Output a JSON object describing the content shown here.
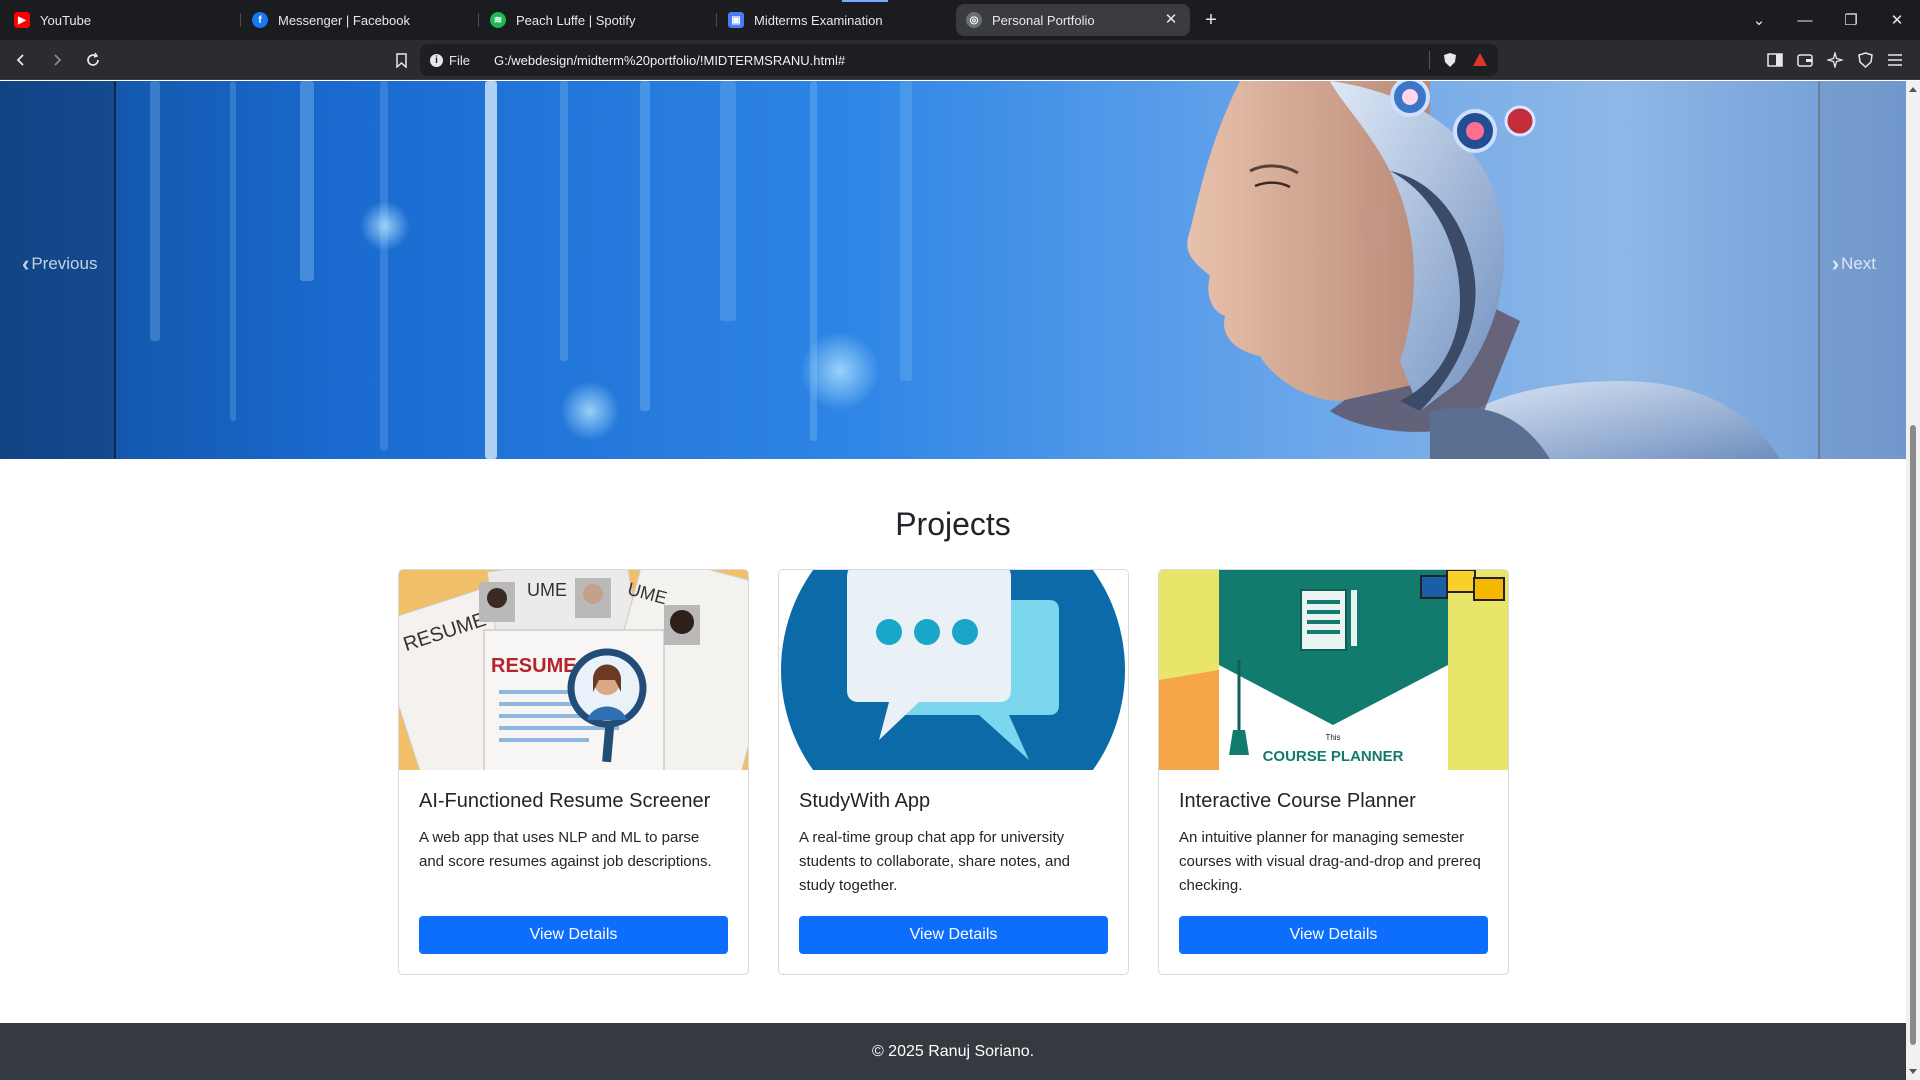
{
  "tabs": [
    {
      "label": "YouTube",
      "icon": "youtube-icon",
      "color": "#ff0000"
    },
    {
      "label": "Messenger | Facebook",
      "icon": "facebook-icon",
      "color": "#1877f2"
    },
    {
      "label": "Peach Luffe | Spotify",
      "icon": "spotify-icon",
      "color": "#1db954"
    },
    {
      "label": "Midterms Examination",
      "icon": "classroom-icon",
      "color": "#4a7bf7"
    },
    {
      "label": "Personal Portfolio",
      "icon": "globe-icon",
      "color": "#9aa0a6"
    }
  ],
  "toolbar": {
    "site_info": "File",
    "url": "G:/webdesign/midterm%20portfolio/!MIDTERMSRANU.html#"
  },
  "carousel": {
    "prev_label": "Previous",
    "next_label": "Next"
  },
  "projects": {
    "heading": "Projects",
    "cards": [
      {
        "title": "AI-Functioned Resume Screener",
        "description": "A web app that uses NLP and ML to parse and score resumes against job descriptions.",
        "button": "View Details",
        "image_text": [
          "RESUME",
          "UME",
          "UME",
          "RESUME"
        ]
      },
      {
        "title": "StudyWith App",
        "description": "A real-time group chat app for university students to collaborate, share notes, and study together.",
        "button": "View Details"
      },
      {
        "title": "Interactive Course Planner",
        "description": "An intuitive planner for managing semester courses with visual drag-and-drop and prereq checking.",
        "button": "View Details",
        "image_text": [
          "This",
          "COURSE PLANNER"
        ]
      }
    ]
  },
  "footer": {
    "text": "© 2025 Ranuj Soriano."
  },
  "colors": {
    "primary_button": "#0d6efd",
    "footer_bg": "#343a40"
  }
}
